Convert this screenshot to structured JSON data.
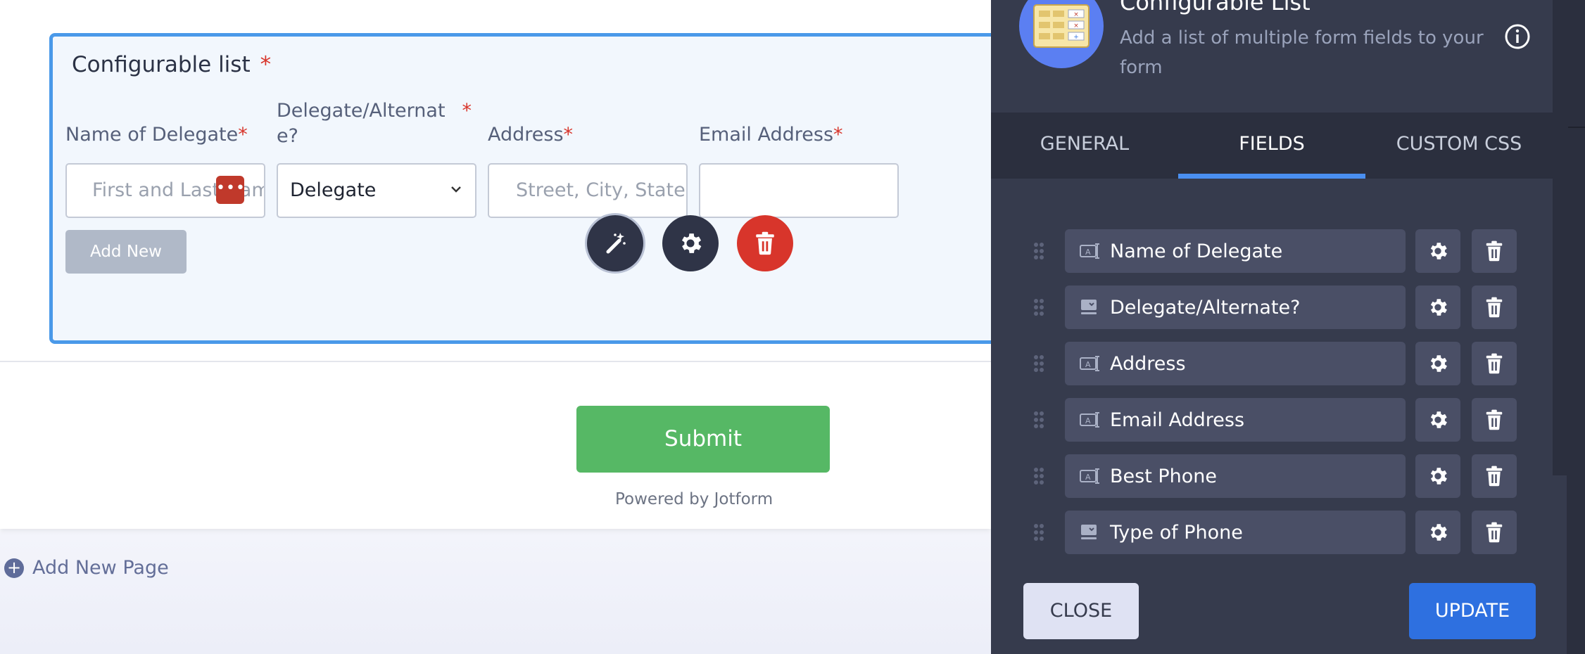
{
  "form": {
    "widget_title": "Configurable list",
    "required_mark": "*",
    "columns": [
      {
        "label": "Name of Delegate",
        "placeholder": "First and Last Nam",
        "required": "*"
      },
      {
        "label": "Delegate/Alternat",
        "label_line2": "e?",
        "value": "Delegate",
        "required": "*"
      },
      {
        "label": "Address",
        "placeholder": "Street, City, State,",
        "required": "*"
      },
      {
        "label": "Email Address",
        "placeholder": "",
        "required": "*"
      }
    ],
    "dots_badge": "•••",
    "add_new_label": "Add New",
    "submit_label": "Submit",
    "powered_by": "Powered by Jotform",
    "add_new_page": "Add New Page"
  },
  "panel": {
    "title": "Configurable List",
    "description": "Add a list of multiple form fields to your form",
    "tabs": [
      {
        "label": "GENERAL",
        "active": false
      },
      {
        "label": "FIELDS",
        "active": true
      },
      {
        "label": "CUSTOM CSS",
        "active": false
      }
    ],
    "fields": [
      {
        "label": "Name of Delegate",
        "icon": "textbox-icon"
      },
      {
        "label": "Delegate/Alternate?",
        "icon": "dropdown-icon"
      },
      {
        "label": "Address",
        "icon": "textbox-icon"
      },
      {
        "label": "Email Address",
        "icon": "textbox-icon"
      },
      {
        "label": "Best Phone",
        "icon": "textbox-icon"
      },
      {
        "label": "Type of Phone",
        "icon": "dropdown-icon"
      }
    ],
    "close_label": "CLOSE",
    "update_label": "UPDATE"
  },
  "colors": {
    "accent": "#4a99e9",
    "submit": "#56b865",
    "delete": "#d8352b",
    "panel_bg": "#363b4d",
    "update": "#2e70e0"
  }
}
